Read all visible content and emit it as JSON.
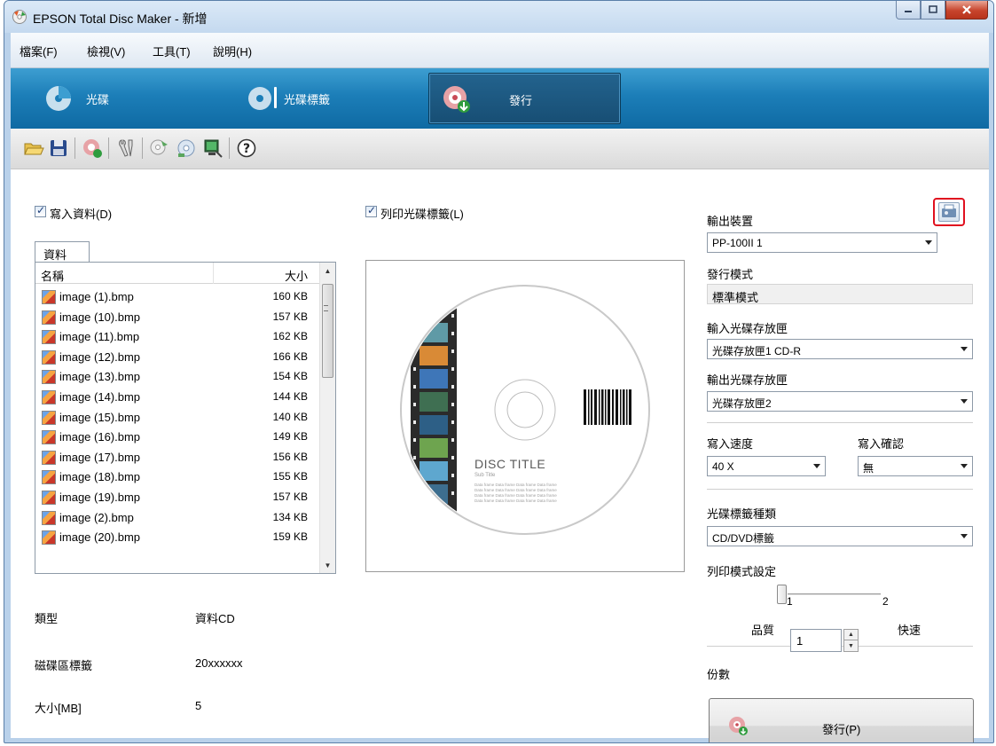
{
  "window": {
    "title": "EPSON Total Disc Maker - 新增"
  },
  "menu": [
    "檔案(F)",
    "檢視(V)",
    "工具(T)",
    "說明(H)"
  ],
  "modes": [
    {
      "label": "光碟",
      "active": false
    },
    {
      "label": "光碟標籤",
      "active": false
    },
    {
      "label": "發行",
      "active": true
    }
  ],
  "toolbar": {
    "icons": [
      "open-folder-icon",
      "save-icon",
      "publish-icon",
      "tools-icon",
      "disc-settings-icon",
      "disc-copy-icon",
      "monitor-icon",
      "help-icon"
    ]
  },
  "left": {
    "write_data_label": "寫入資料(D)",
    "write_data_checked": true,
    "tab_label": "資料",
    "columns": {
      "name": "名稱",
      "size": "大小"
    },
    "files": [
      {
        "name": "image (1).bmp",
        "size": "160 KB"
      },
      {
        "name": "image (10).bmp",
        "size": "157 KB"
      },
      {
        "name": "image (11).bmp",
        "size": "162 KB"
      },
      {
        "name": "image (12).bmp",
        "size": "166 KB"
      },
      {
        "name": "image (13).bmp",
        "size": "154 KB"
      },
      {
        "name": "image (14).bmp",
        "size": "144 KB"
      },
      {
        "name": "image (15).bmp",
        "size": "140 KB"
      },
      {
        "name": "image (16).bmp",
        "size": "149 KB"
      },
      {
        "name": "image (17).bmp",
        "size": "156 KB"
      },
      {
        "name": "image (18).bmp",
        "size": "155 KB"
      },
      {
        "name": "image (19).bmp",
        "size": "157 KB"
      },
      {
        "name": "image (2).bmp",
        "size": "134 KB"
      },
      {
        "name": "image (20).bmp",
        "size": "159 KB"
      }
    ],
    "info": [
      {
        "label": "類型",
        "value": "資料CD"
      },
      {
        "label": "磁碟區標籤",
        "value": "20xxxxxx"
      },
      {
        "label": "大小[MB]",
        "value": "5"
      }
    ]
  },
  "middle": {
    "print_label_label": "列印光碟標籤(L)",
    "print_label_checked": true,
    "disc_title": "DISC TITLE",
    "disc_subtitle": "Sub Title",
    "disc_data_lines": [
      "Data frame Data frame Data frame Data frame",
      "Data frame Data frame Data frame Data frame",
      "Data frame Data frame Data frame Data frame",
      "Data frame Data frame Data frame Data frame"
    ]
  },
  "right": {
    "output_device_label": "輸出裝置",
    "output_device_value": "PP-100II 1",
    "publish_mode_label": "發行模式",
    "publish_mode_value": "標準模式",
    "input_stacker_label": "輸入光碟存放匣",
    "input_stacker_value": "光碟存放匣1 CD-R",
    "output_stacker_label": "輸出光碟存放匣",
    "output_stacker_value": "光碟存放匣2",
    "write_speed_label": "寫入速度",
    "write_speed_value": "40 X",
    "write_verify_label": "寫入確認",
    "write_verify_value": "無",
    "label_type_label": "光碟標籤種類",
    "label_type_value": "CD/DVD標籤",
    "print_mode_label": "列印模式設定",
    "print_mode_tick1": "1",
    "print_mode_tick2": "2",
    "print_mode_left": "品質",
    "print_mode_right": "快速",
    "print_mode_level": 1,
    "copies_label": "份數",
    "copies_value": "1",
    "publish_button": "發行(P)"
  }
}
